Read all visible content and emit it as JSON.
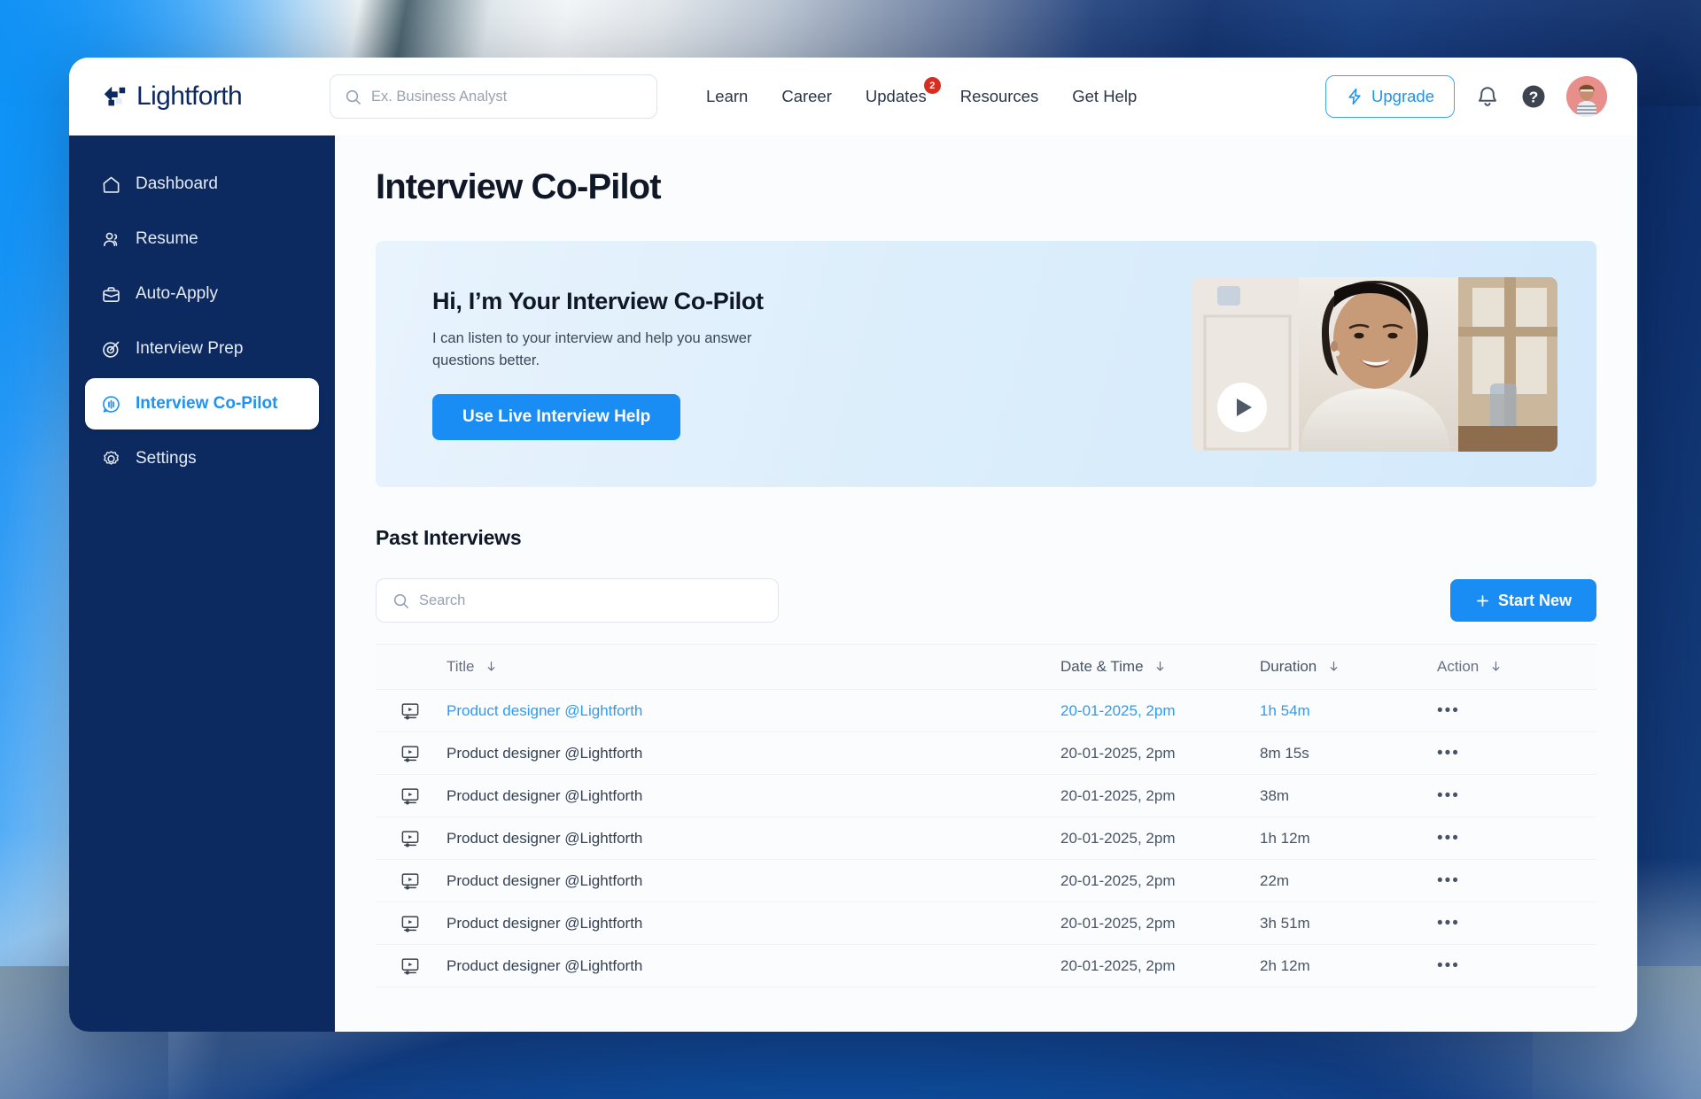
{
  "brand": {
    "name": "Lightforth",
    "logo_icon": "lightforth-logo-icon"
  },
  "search": {
    "placeholder": "Ex. Business Analyst",
    "value": "",
    "icon": "search-icon"
  },
  "topnav": {
    "items": [
      {
        "label": "Learn",
        "badge": ""
      },
      {
        "label": "Career",
        "badge": ""
      },
      {
        "label": "Updates",
        "badge": "2"
      },
      {
        "label": "Resources",
        "badge": ""
      },
      {
        "label": "Get Help",
        "badge": ""
      }
    ],
    "upgrade_label": "Upgrade",
    "upgrade_icon": "lightning-bolt-icon",
    "notification_icon": "bell-icon",
    "help_icon": "question-circle-icon",
    "avatar_icon": "user-avatar"
  },
  "sidebar": {
    "items": [
      {
        "label": "Dashboard",
        "icon": "home-icon",
        "active": false
      },
      {
        "label": "Resume",
        "icon": "users-icon",
        "active": false
      },
      {
        "label": "Auto-Apply",
        "icon": "briefcase-icon",
        "active": false
      },
      {
        "label": "Interview Prep",
        "icon": "target-icon",
        "active": false
      },
      {
        "label": "Interview Co-Pilot",
        "icon": "copilot-icon",
        "active": true
      },
      {
        "label": "Settings",
        "icon": "gear-icon",
        "active": false
      }
    ]
  },
  "page": {
    "title": "Interview Co-Pilot"
  },
  "hero": {
    "title": "Hi, I’m Your Interview Co-Pilot",
    "subtitle": "I can listen to your interview and help you answer questions better.",
    "cta_label": "Use Live Interview Help",
    "video_play_icon": "play-icon"
  },
  "past_interviews": {
    "title": "Past Interviews",
    "search": {
      "placeholder": "Search",
      "value": "",
      "icon": "search-icon"
    },
    "start_new_label": "Start New",
    "start_new_icon": "plus-icon",
    "columns": [
      {
        "label": "Title",
        "sort_icon": "arrow-down-icon"
      },
      {
        "label": "Date & Time",
        "sort_icon": "arrow-down-icon"
      },
      {
        "label": "Duration",
        "sort_icon": "arrow-down-icon"
      },
      {
        "label": "Action",
        "sort_icon": "arrow-down-icon"
      }
    ],
    "rows": [
      {
        "icon": "video-recording-icon",
        "title": "Product designer @Lightforth",
        "datetime": "20-01-2025, 2pm",
        "duration": "1h 54m",
        "action": "•••",
        "highlight": true
      },
      {
        "icon": "video-recording-icon",
        "title": "Product designer @Lightforth",
        "datetime": "20-01-2025, 2pm",
        "duration": "8m 15s",
        "action": "•••",
        "highlight": false
      },
      {
        "icon": "video-recording-icon",
        "title": "Product designer @Lightforth",
        "datetime": "20-01-2025, 2pm",
        "duration": "38m",
        "action": "•••",
        "highlight": false
      },
      {
        "icon": "video-recording-icon",
        "title": "Product designer @Lightforth",
        "datetime": "20-01-2025, 2pm",
        "duration": "1h 12m",
        "action": "•••",
        "highlight": false
      },
      {
        "icon": "video-recording-icon",
        "title": "Product designer @Lightforth",
        "datetime": "20-01-2025, 2pm",
        "duration": "22m",
        "action": "•••",
        "highlight": false
      },
      {
        "icon": "video-recording-icon",
        "title": "Product designer @Lightforth",
        "datetime": "20-01-2025, 2pm",
        "duration": "3h 51m",
        "action": "•••",
        "highlight": false
      },
      {
        "icon": "video-recording-icon",
        "title": "Product designer @Lightforth",
        "datetime": "20-01-2025, 2pm",
        "duration": "2h 12m",
        "action": "•••",
        "highlight": false
      }
    ]
  },
  "colors": {
    "brand_navy": "#0d2a60",
    "accent_blue": "#1a8df5",
    "link_blue": "#2e9bf5",
    "badge_red": "#d92d20",
    "hero_bg": "#dceefb",
    "content_bg": "#fbfcfd"
  }
}
